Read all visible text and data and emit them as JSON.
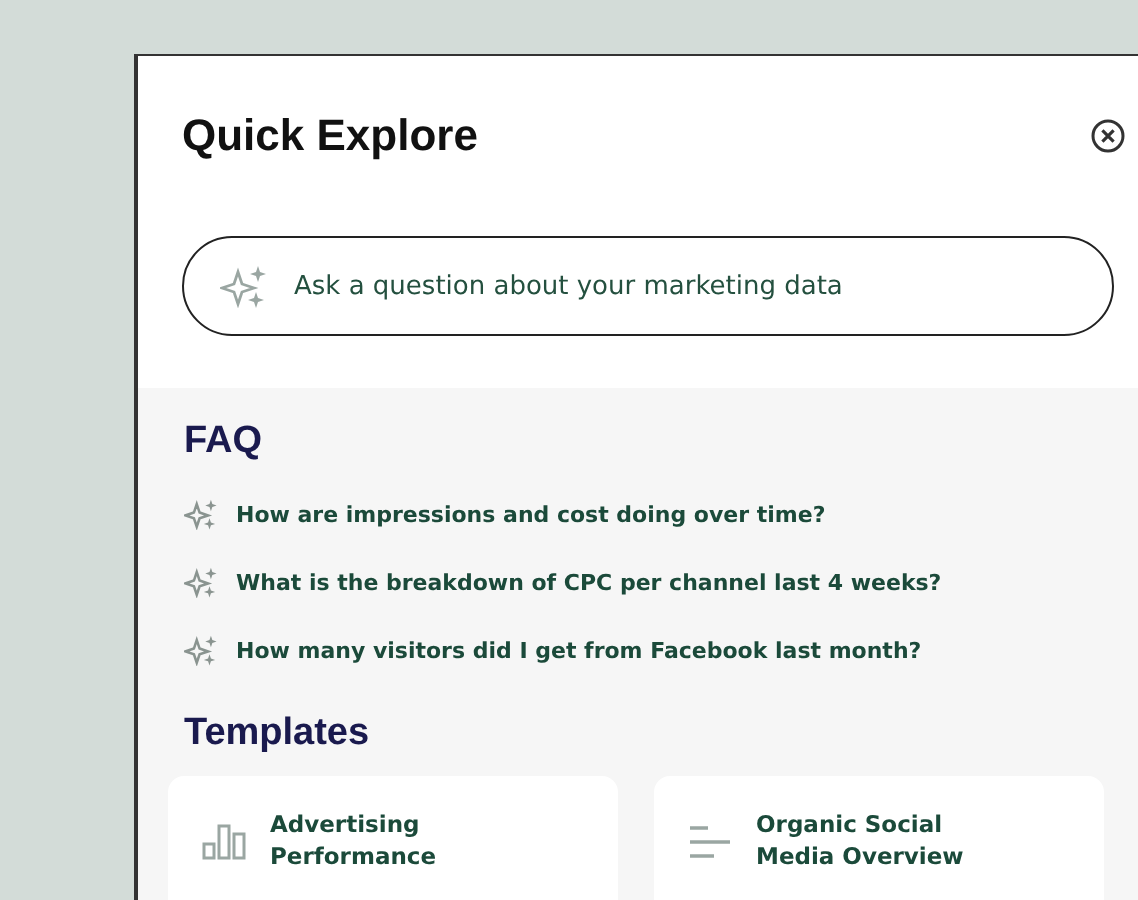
{
  "panel": {
    "title": "Quick Explore"
  },
  "search": {
    "placeholder": "Ask a question about your marketing data"
  },
  "faq": {
    "heading": "FAQ",
    "items": [
      "How are impressions and cost doing over time?",
      "What is the breakdown of CPC per channel last 4 weeks?",
      "How many visitors did I get from Facebook last month?"
    ]
  },
  "templates": {
    "heading": "Templates",
    "items": [
      {
        "kind": "bars",
        "line1": "Advertising",
        "line2": "Performance"
      },
      {
        "kind": "lines",
        "line1": "Organic Social",
        "line2": "Media Overview"
      }
    ]
  }
}
